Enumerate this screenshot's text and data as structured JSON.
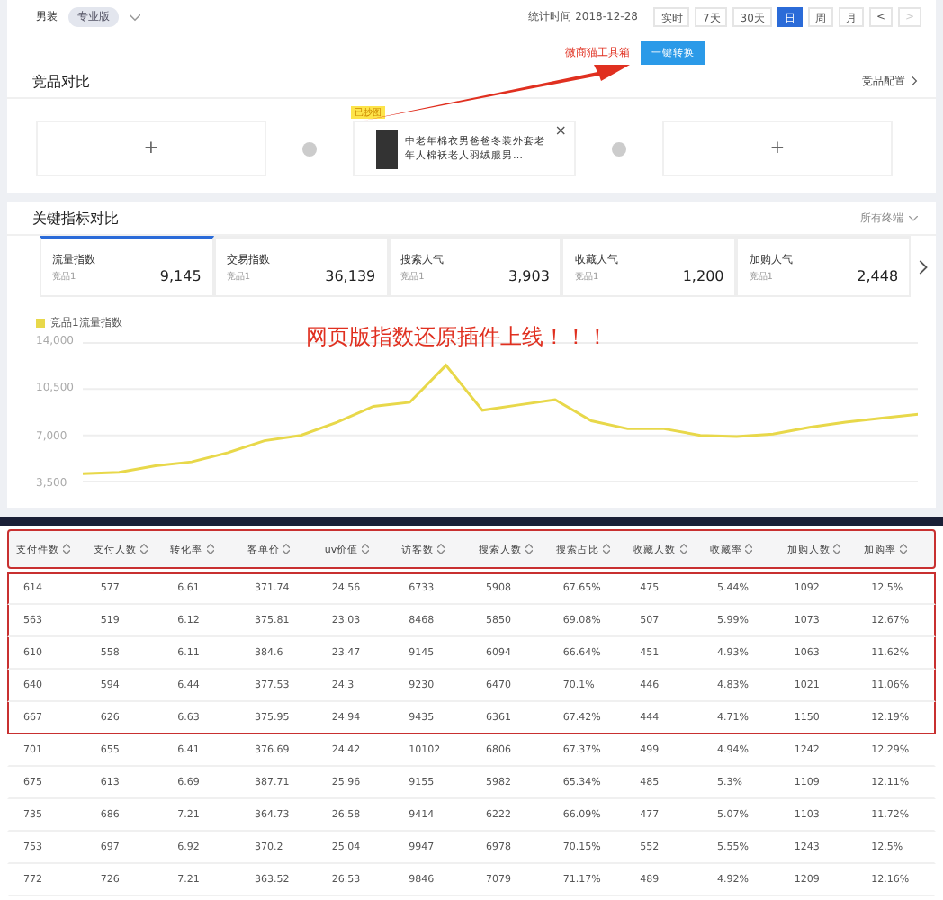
{
  "header": {
    "category": "男装",
    "edition_badge": "专业版",
    "stat_time": "统计时间 2018-12-28",
    "period_buttons": [
      {
        "label": "实时",
        "selected": false
      },
      {
        "label": "7天",
        "selected": false
      },
      {
        "label": "30天",
        "selected": false
      },
      {
        "label": "日",
        "selected": true
      },
      {
        "label": "周",
        "selected": false
      },
      {
        "label": "月",
        "selected": false
      }
    ],
    "prev": "<",
    "next": ">"
  },
  "annotation": {
    "label": "微商猫工具箱",
    "button": "一键转换"
  },
  "compare": {
    "title": "竞品对比",
    "config_link": "竞品配置",
    "product": {
      "tag": "已抄图",
      "title": "中老年棉衣男爸爸冬装外套老年人棉袄老人羽绒服男…",
      "close": "×"
    },
    "add_slots": [
      "+",
      "+"
    ]
  },
  "metrics": {
    "title": "关键指标对比",
    "terminal": "所有终端",
    "tabs": [
      {
        "label": "流量指数",
        "sub": "竞品1",
        "value": "9,145",
        "selected": true
      },
      {
        "label": "交易指数",
        "sub": "竞品1",
        "value": "36,139",
        "selected": false
      },
      {
        "label": "搜索人气",
        "sub": "竞品1",
        "value": "3,903",
        "selected": false
      },
      {
        "label": "收藏人气",
        "sub": "竞品1",
        "value": "1,200",
        "selected": false
      },
      {
        "label": "加购人气",
        "sub": "竞品1",
        "value": "2,448",
        "selected": false
      }
    ],
    "overlay_text": "网页版指数还原插件上线！！！",
    "chart_data": {
      "type": "line",
      "ylim": [
        3500,
        14000
      ],
      "yticks": [
        {
          "value": 3500,
          "label": "3,500"
        },
        {
          "value": 7000,
          "label": "7,000"
        },
        {
          "value": 10500,
          "label": "10,500"
        },
        {
          "value": 14000,
          "label": "14,000"
        }
      ],
      "series": [
        {
          "name": "竞品1流量指数",
          "color": "#e8d84a",
          "values": [
            4100,
            4200,
            4700,
            5000,
            5700,
            6600,
            7000,
            8000,
            9200,
            9500,
            12300,
            8900,
            9300,
            9700,
            8100,
            7500,
            7500,
            7000,
            6900,
            7100,
            7600,
            8000,
            8300,
            8600
          ]
        }
      ]
    }
  },
  "table": {
    "header_highlighted": true,
    "columns": [
      "支付件数",
      "支付人数",
      "转化率",
      "客单价",
      "uv价值",
      "访客数",
      "搜索人数",
      "搜索占比",
      "收藏人数",
      "收藏率",
      "加购人数",
      "加购率"
    ],
    "rows": [
      {
        "highlighted": true,
        "cells": [
          "614",
          "577",
          "6.61",
          "371.74",
          "24.56",
          "6733",
          "5908",
          "67.65%",
          "475",
          "5.44%",
          "1092",
          "12.5%"
        ]
      },
      {
        "highlighted": true,
        "cells": [
          "563",
          "519",
          "6.12",
          "375.81",
          "23.03",
          "8468",
          "5850",
          "69.08%",
          "507",
          "5.99%",
          "1073",
          "12.67%"
        ]
      },
      {
        "highlighted": true,
        "cells": [
          "610",
          "558",
          "6.11",
          "384.6",
          "23.47",
          "9145",
          "6094",
          "66.64%",
          "451",
          "4.93%",
          "1063",
          "11.62%"
        ]
      },
      {
        "highlighted": true,
        "cells": [
          "640",
          "594",
          "6.44",
          "377.53",
          "24.3",
          "9230",
          "6470",
          "70.1%",
          "446",
          "4.83%",
          "1021",
          "11.06%"
        ]
      },
      {
        "highlighted": true,
        "cells": [
          "667",
          "626",
          "6.63",
          "375.95",
          "24.94",
          "9435",
          "6361",
          "67.42%",
          "444",
          "4.71%",
          "1150",
          "12.19%"
        ]
      },
      {
        "highlighted": false,
        "cells": [
          "701",
          "655",
          "6.41",
          "376.69",
          "24.42",
          "10102",
          "6806",
          "67.37%",
          "499",
          "4.94%",
          "1242",
          "12.29%"
        ]
      },
      {
        "highlighted": false,
        "cells": [
          "675",
          "613",
          "6.69",
          "387.71",
          "25.96",
          "9155",
          "5982",
          "65.34%",
          "485",
          "5.3%",
          "1109",
          "12.11%"
        ]
      },
      {
        "highlighted": false,
        "cells": [
          "735",
          "686",
          "7.21",
          "364.73",
          "26.58",
          "9414",
          "6222",
          "66.09%",
          "477",
          "5.07%",
          "1103",
          "11.72%"
        ]
      },
      {
        "highlighted": false,
        "cells": [
          "753",
          "697",
          "6.92",
          "370.2",
          "25.04",
          "9947",
          "6978",
          "70.15%",
          "552",
          "5.55%",
          "1243",
          "12.5%"
        ]
      },
      {
        "highlighted": false,
        "cells": [
          "772",
          "726",
          "7.21",
          "363.52",
          "26.53",
          "9846",
          "7079",
          "71.17%",
          "489",
          "4.92%",
          "1209",
          "12.16%"
        ]
      }
    ]
  }
}
